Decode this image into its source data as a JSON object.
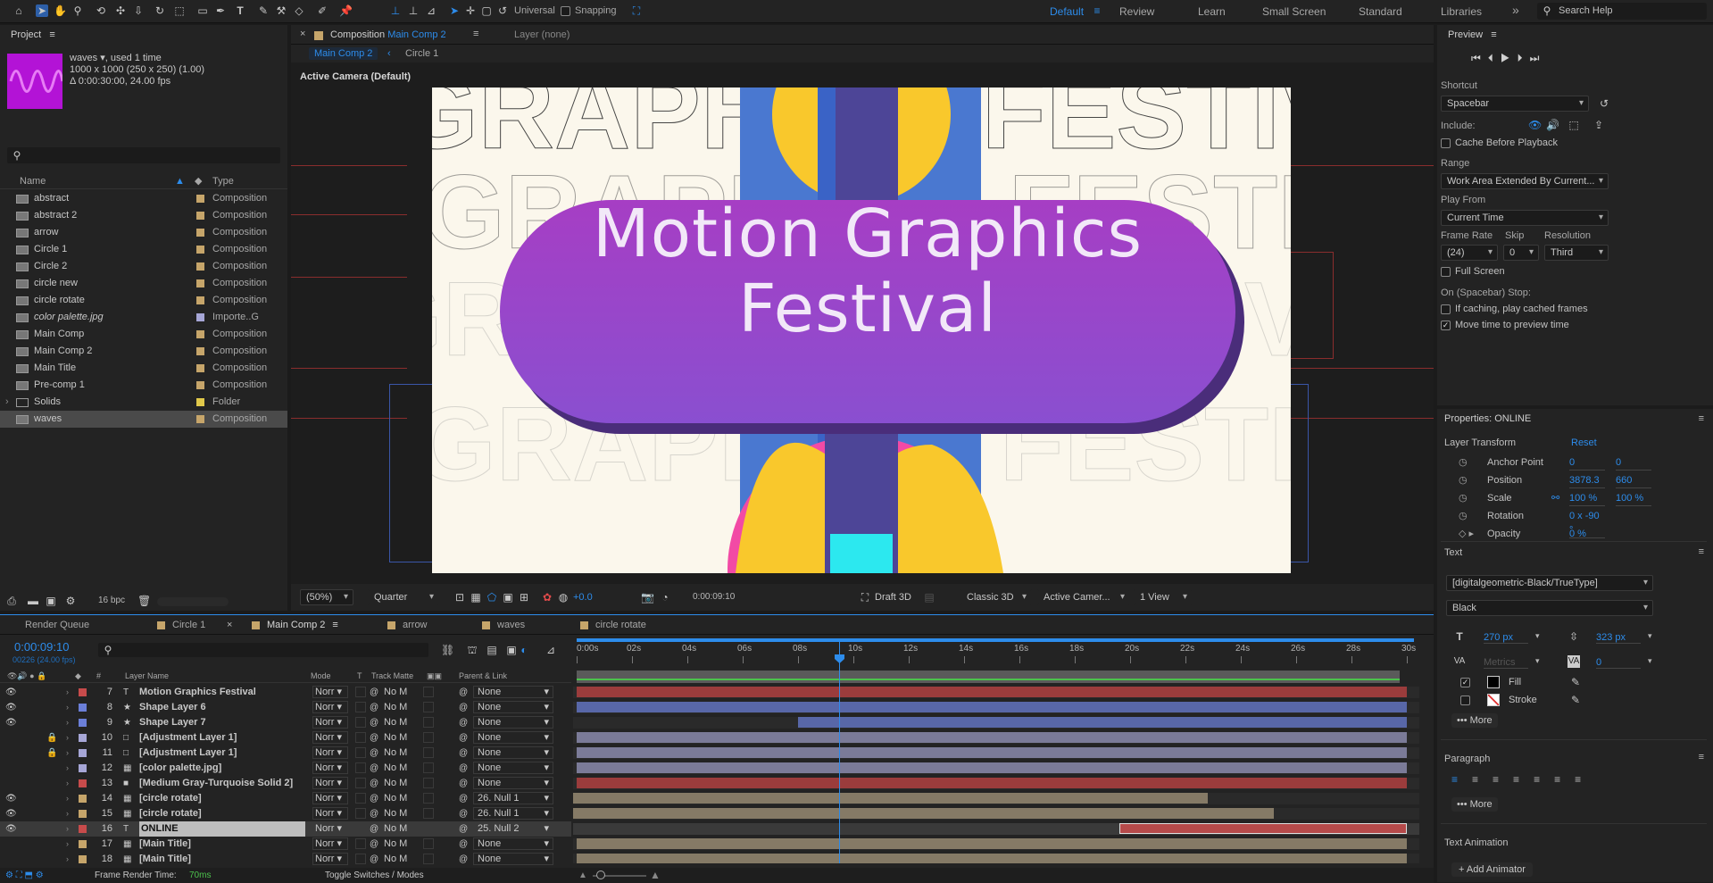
{
  "toolbar": {
    "snapping_label": "Snapping",
    "universal_label": "Universal",
    "workspaces": [
      "Default",
      "Review",
      "Learn",
      "Small Screen",
      "Standard",
      "Libraries"
    ],
    "search_help": "Search Help",
    "more": "»"
  },
  "project": {
    "title": "Project",
    "item_name": "waves ▾",
    "used": ", used 1 time",
    "dims": "1000 x 1000  (250 x 250) (1.00)",
    "duration": "Δ 0:00:30:00, 24.00 fps",
    "col_name": "Name",
    "col_type": "Type",
    "bpc": "16 bpc",
    "items": [
      {
        "name": "abstract",
        "type": "Composition",
        "color": "#c6a56a"
      },
      {
        "name": "abstract 2",
        "type": "Composition",
        "color": "#c6a56a"
      },
      {
        "name": "arrow",
        "type": "Composition",
        "color": "#c6a56a"
      },
      {
        "name": "Circle 1",
        "type": "Composition",
        "color": "#c6a56a"
      },
      {
        "name": "Circle 2",
        "type": "Composition",
        "color": "#c6a56a"
      },
      {
        "name": "circle new",
        "type": "Composition",
        "color": "#c6a56a"
      },
      {
        "name": "circle rotate",
        "type": "Composition",
        "color": "#c6a56a"
      },
      {
        "name": "color palette.jpg",
        "type": "Importe..G",
        "color": "#a6a6d6"
      },
      {
        "name": "Main Comp",
        "type": "Composition",
        "color": "#c6a56a"
      },
      {
        "name": "Main Comp 2",
        "type": "Composition",
        "color": "#c6a56a"
      },
      {
        "name": "Main Title",
        "type": "Composition",
        "color": "#c6a56a"
      },
      {
        "name": "Pre-comp 1",
        "type": "Composition",
        "color": "#c6a56a"
      },
      {
        "name": "Solids",
        "type": "Folder",
        "color": "#e0c84a"
      },
      {
        "name": "waves",
        "type": "Composition",
        "color": "#c6a56a"
      }
    ]
  },
  "comp": {
    "tab_prefix": "Composition",
    "tab_name": "Main Comp 2",
    "layer_tab": "Layer (none)",
    "breadcrumb_1": "Main Comp 2",
    "breadcrumb_2": "Circle 1",
    "camera": "Active Camera (Default)",
    "title_line1": "Motion Graphics",
    "title_line2": "Festival",
    "bg_word": "GRAPHICS FESTIVAL",
    "footer": {
      "zoom": "(50%)",
      "quality": "Quarter",
      "exposure": "+0.0",
      "timecode": "0:00:09:10",
      "draft": "Draft 3D",
      "renderer": "Classic 3D",
      "camera": "Active Camer...",
      "view": "1 View"
    }
  },
  "preview": {
    "title": "Preview",
    "shortcut_label": "Shortcut",
    "shortcut": "Spacebar",
    "include_label": "Include:",
    "cache_label": "Cache Before Playback",
    "range_label": "Range",
    "range": "Work Area Extended By Current...",
    "play_from_label": "Play From",
    "play_from": "Current Time",
    "frame_rate_label": "Frame Rate",
    "skip_label": "Skip",
    "resolution_label": "Resolution",
    "frame_rate": "(24)",
    "skip": "0",
    "resolution": "Third",
    "full_screen": "Full Screen",
    "stop_label": "On (Spacebar) Stop:",
    "if_caching": "If caching, play cached frames",
    "move_time": "Move time to preview time"
  },
  "properties": {
    "title": "Properties: ONLINE",
    "transform_label": "Layer Transform",
    "reset": "Reset",
    "rows": [
      {
        "label": "Anchor Point",
        "v1": "0",
        "v2": "0"
      },
      {
        "label": "Position",
        "v1": "3878.3",
        "v2": "660"
      },
      {
        "label": "Scale",
        "v1": "100 %",
        "v2": "100 %"
      },
      {
        "label": "Rotation",
        "v1": "0 x -90 °",
        "v2": ""
      },
      {
        "label": "Opacity",
        "v1": "0 %",
        "v2": ""
      }
    ],
    "text_label": "Text",
    "font": "[digitalgeometric-Black/TrueType]",
    "style": "Black",
    "font_size": "270 px",
    "leading": "323 px",
    "kerning": "Metrics",
    "tracking": "0",
    "fill": "Fill",
    "stroke": "Stroke",
    "more": "More",
    "paragraph": "Paragraph",
    "text_animation": "Text Animation",
    "add_animator": "Add Animator"
  },
  "timeline": {
    "tabs": [
      "Render Queue",
      "Circle 1",
      "Main Comp 2",
      "arrow",
      "waves",
      "circle rotate"
    ],
    "timecode": "0:00:09:10",
    "frames": "00226 (24.00 fps)",
    "col_num": "#",
    "col_layer": "Layer Name",
    "col_mode": "Mode",
    "col_t": "T",
    "col_matte": "Track Matte",
    "col_parent": "Parent & Link",
    "ruler": [
      "0:00s",
      "02s",
      "04s",
      "06s",
      "08s",
      "10s",
      "12s",
      "14s",
      "16s",
      "18s",
      "20s",
      "22s",
      "24s",
      "26s",
      "28s",
      "30s"
    ],
    "render_time_label": "Frame Render Time:",
    "render_time": "70ms",
    "toggle": "Toggle Switches / Modes",
    "layers": [
      {
        "num": "7",
        "icon": "T",
        "name": "Motion Graphics Festival",
        "mode": "Norr",
        "matte": "No M",
        "parent": "None",
        "label": "#c74b4b",
        "eye": true,
        "lock": false,
        "bar_color": "#9b3c3c",
        "in": 0,
        "out": 30
      },
      {
        "num": "8",
        "icon": "★",
        "name": "Shape Layer 6",
        "mode": "Norr",
        "matte": "No M",
        "parent": "None",
        "label": "#6b7fd8",
        "eye": true,
        "lock": false,
        "bar_color": "#5867a8",
        "in": 0,
        "out": 30
      },
      {
        "num": "9",
        "icon": "★",
        "name": "Shape Layer 7",
        "mode": "Norr",
        "matte": "No M",
        "parent": "None",
        "label": "#6b7fd8",
        "eye": true,
        "lock": false,
        "bar_color": "#5867a8",
        "in": 8,
        "out": 30
      },
      {
        "num": "10",
        "icon": "□",
        "name": "[Adjustment Layer 1]",
        "mode": "Norr",
        "matte": "No M",
        "parent": "None",
        "label": "#a6a6d6",
        "eye": false,
        "lock": true,
        "bar_color": "#7b7b98",
        "in": 0,
        "out": 30
      },
      {
        "num": "11",
        "icon": "□",
        "name": "[Adjustment Layer 1]",
        "mode": "Norr",
        "matte": "No M",
        "parent": "None",
        "label": "#a6a6d6",
        "eye": false,
        "lock": true,
        "bar_color": "#7b7b98",
        "in": 0,
        "out": 30
      },
      {
        "num": "12",
        "icon": "▦",
        "name": "[color palette.jpg]",
        "mode": "Norr",
        "matte": "No M",
        "parent": "None",
        "label": "#a6a6d6",
        "eye": false,
        "lock": false,
        "bar_color": "#7b7b98",
        "in": 0,
        "out": 30
      },
      {
        "num": "13",
        "icon": "■",
        "name": "[Medium Gray-Turquoise Solid 2]",
        "mode": "Norr",
        "matte": "No M",
        "parent": "None",
        "label": "#c74b4b",
        "eye": false,
        "lock": false,
        "bar_color": "#9b3c3c",
        "in": 0,
        "out": 30
      },
      {
        "num": "14",
        "icon": "▦",
        "name": "[circle rotate]",
        "mode": "Norr",
        "matte": "No M",
        "parent": "26. Null 1",
        "label": "#c6a56a",
        "eye": true,
        "lock": false,
        "bar_color": "#857a66",
        "in": -0.2,
        "out": 22.8
      },
      {
        "num": "15",
        "icon": "▦",
        "name": "[circle rotate]",
        "mode": "Norr",
        "matte": "No M",
        "parent": "26. Null 1",
        "label": "#c6a56a",
        "eye": true,
        "lock": false,
        "bar_color": "#857a66",
        "in": -0.2,
        "out": 25.2
      },
      {
        "num": "16",
        "icon": "T",
        "name": "ONLINE",
        "mode": "Norr",
        "matte": "No M",
        "parent": "25. Null 2",
        "label": "#c74b4b",
        "eye": true,
        "lock": false,
        "bar_color": "#b54a4a",
        "in": 19.6,
        "out": 30,
        "selected": true
      },
      {
        "num": "17",
        "icon": "▦",
        "name": "[Main Title]",
        "mode": "Norr",
        "matte": "No M",
        "parent": "None",
        "label": "#c6a56a",
        "eye": false,
        "lock": false,
        "bar_color": "#857a66",
        "in": 0,
        "out": 30
      },
      {
        "num": "18",
        "icon": "▦",
        "name": "[Main Title]",
        "mode": "Norr",
        "matte": "No M",
        "parent": "None",
        "label": "#c6a56a",
        "eye": false,
        "lock": false,
        "bar_color": "#857a66",
        "in": 0,
        "out": 30
      }
    ]
  },
  "colors": {
    "accent": "#2d8ceb",
    "title_pill": "#9a40c8",
    "comp_bg": "#fbf7ec"
  }
}
